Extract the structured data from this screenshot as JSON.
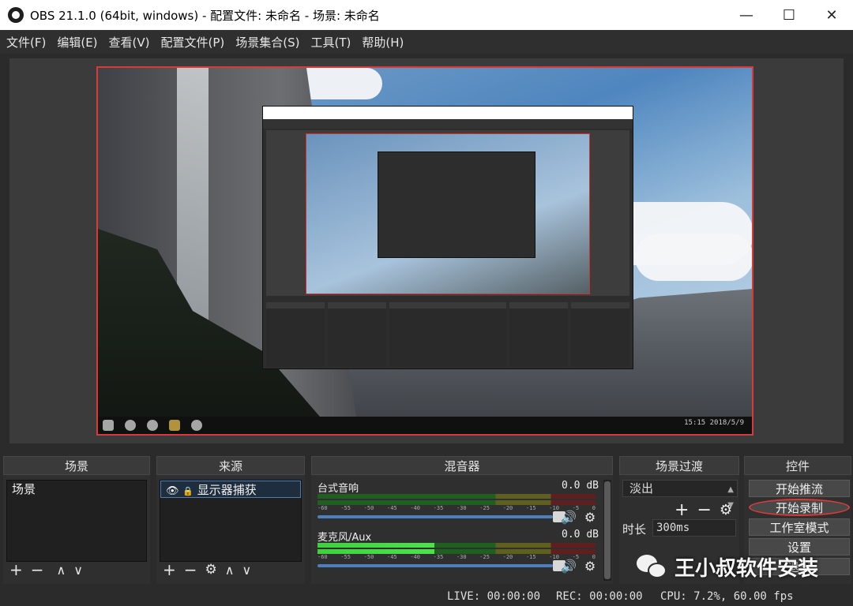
{
  "window": {
    "title": "OBS 21.1.0 (64bit, windows) - 配置文件: 未命名 - 场景: 未命名",
    "minimize": "—",
    "maximize": "☐",
    "close": "✕"
  },
  "menu": [
    "文件(F)",
    "编辑(E)",
    "查看(V)",
    "配置文件(P)",
    "场景集合(S)",
    "工具(T)",
    "帮助(H)"
  ],
  "preview": {
    "taskbar_time": "15:15",
    "taskbar_date": "2018/5/9"
  },
  "docks": {
    "scenes": {
      "header": "场景",
      "items": [
        "场景"
      ]
    },
    "sources": {
      "header": "来源",
      "items": [
        "显示器捕获"
      ]
    },
    "mixer": {
      "header": "混音器",
      "channels": [
        {
          "name": "台式音响",
          "db": "0.0 dB",
          "level": 0.0
        },
        {
          "name": "麦克风/Aux",
          "db": "0.0 dB",
          "level": 0.42
        }
      ],
      "ticks": [
        "-60",
        "-55",
        "-50",
        "-45",
        "-40",
        "-35",
        "-30",
        "-25",
        "-20",
        "-15",
        "-10",
        "-5",
        "0"
      ]
    },
    "transitions": {
      "header": "场景过渡",
      "selected": "淡出",
      "duration_label": "时长",
      "duration_value": "300ms"
    },
    "controls": {
      "header": "控件",
      "buttons": [
        "开始推流",
        "开始录制",
        "工作室模式",
        "设置",
        "退出"
      ]
    }
  },
  "status": {
    "live": "LIVE: 00:00:00",
    "rec": "REC: 00:00:00",
    "cpu": "CPU: 7.2%, 60.00 fps"
  },
  "watermark": "王小叔软件安装"
}
